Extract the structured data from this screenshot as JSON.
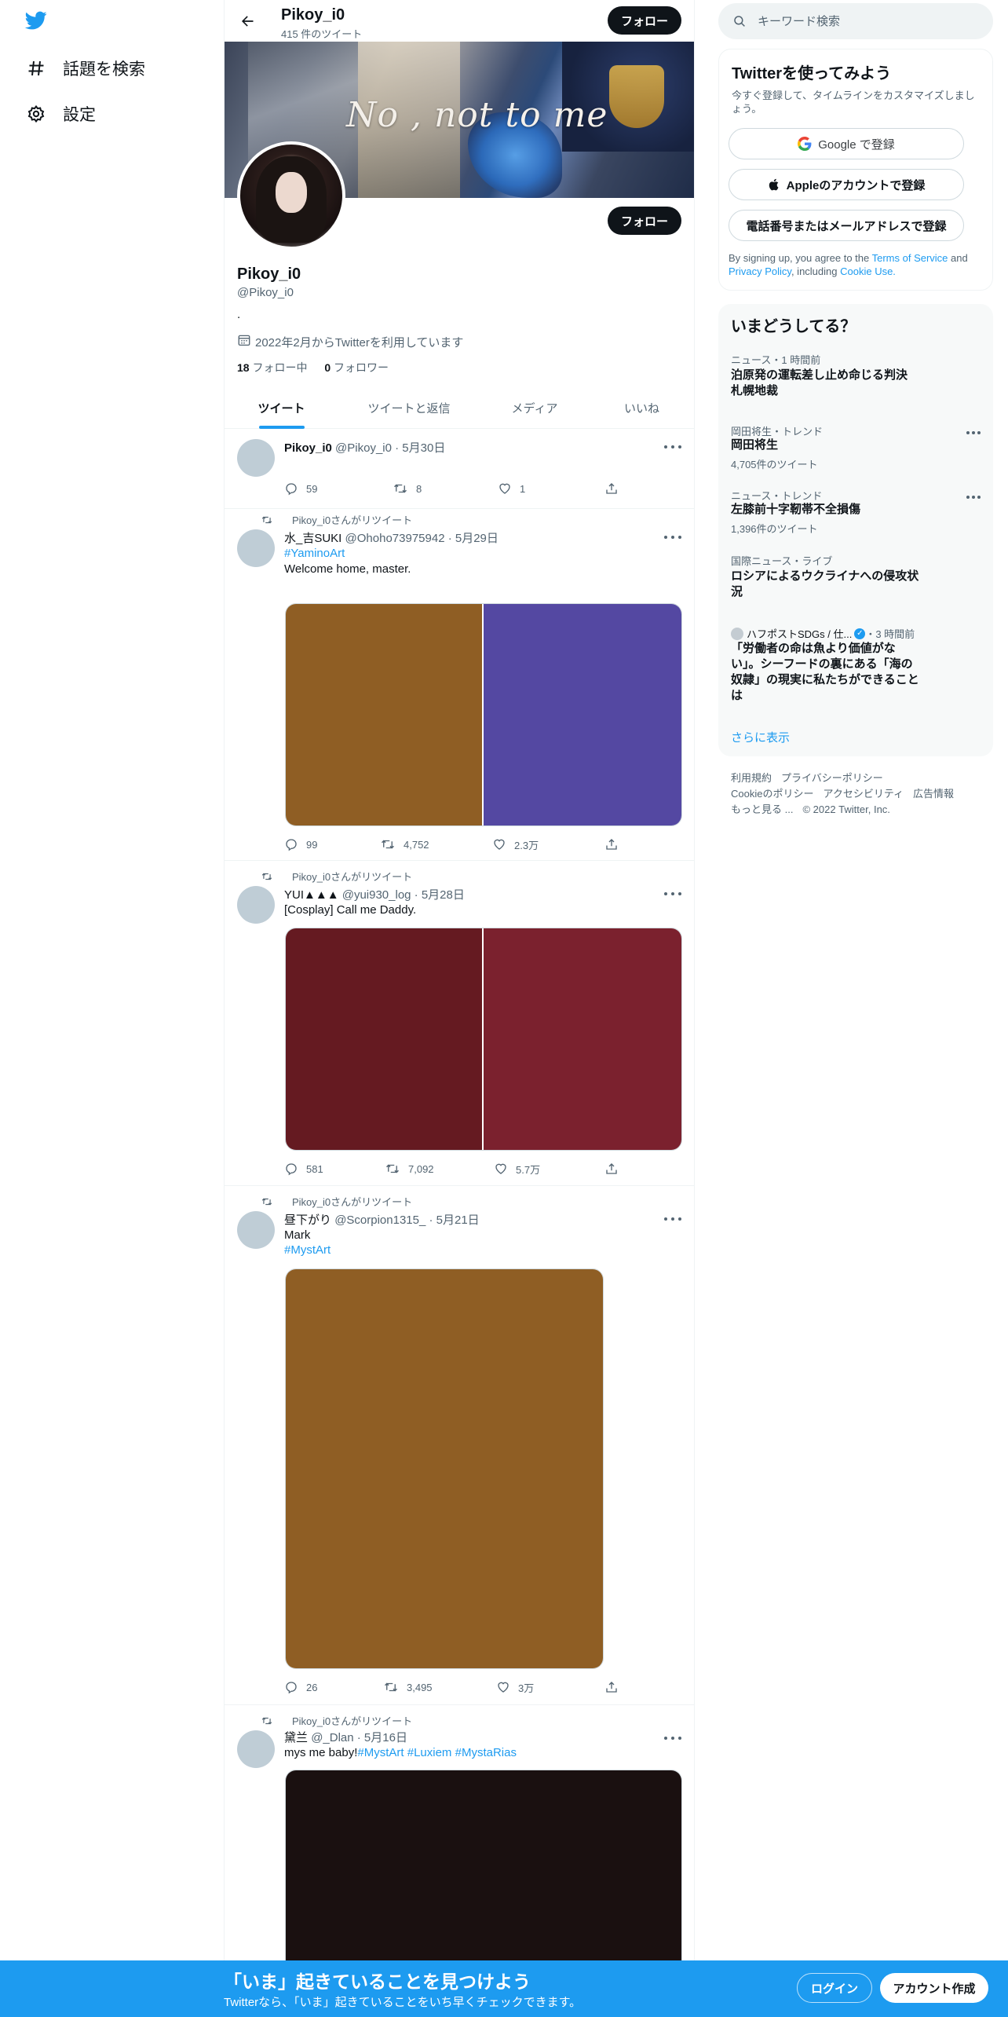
{
  "nav": {
    "explore_label": "話題を検索",
    "settings_label": "設定"
  },
  "header": {
    "name": "Pikoy_i0",
    "tweet_count": "415 件のツイート",
    "follow_label": "フォロー"
  },
  "profile": {
    "banner_text": "No , not to me",
    "name": "Pikoy_i0",
    "handle": "@Pikoy_i0",
    "bio": ".",
    "joined": "2022年2月からTwitterを利用しています",
    "following_count": "18",
    "following_label": "フォロー中",
    "followers_count": "0",
    "followers_label": "フォロワー",
    "follow_label": "フォロー"
  },
  "tabs": [
    {
      "label": "ツイート"
    },
    {
      "label": "ツイートと返信"
    },
    {
      "label": "メディア"
    },
    {
      "label": "いいね"
    }
  ],
  "tweets": [
    {
      "name": "Pikoy_i0",
      "meta": "@Pikoy_i0 · 5月30日",
      "replies": "59",
      "retweets": "8",
      "likes": "1"
    },
    {
      "retweet_label": "Pikoy_i0さんがリツイート",
      "name": "水_吉SUKI",
      "meta": "@Ohoho73975942 · 5月29日",
      "hashtag": "#YaminoArt",
      "text": "Welcome home, master.",
      "media_colors": [
        "#8f5e24",
        "#5448a2"
      ],
      "replies": "99",
      "retweets": "4,752",
      "likes": "2.3万"
    },
    {
      "retweet_label": "Pikoy_i0さんがリツイート",
      "name": "YUI▲▲▲",
      "meta": "@yui930_log · 5月28日",
      "text": "[Cosplay] Call me Daddy.",
      "media_colors": [
        "#651a21",
        "#7b212e"
      ],
      "replies": "581",
      "retweets": "7,092",
      "likes": "5.7万"
    },
    {
      "retweet_label": "Pikoy_i0さんがリツイート",
      "name": "昼下がり",
      "meta": "@Scorpion1315_ · 5月21日",
      "text": "Mark",
      "hashtag": " #MystArt",
      "media_colors": [
        "#8f5e24"
      ],
      "replies": "26",
      "retweets": "3,495",
      "likes": "3万"
    },
    {
      "retweet_label": "Pikoy_i0さんがリツイート",
      "name": "黛兰",
      "meta": "@_Dlan · 5月16日",
      "text": "mys me baby!",
      "tags": [
        "#MystArt",
        "#Luxiem",
        "#MystaRias"
      ],
      "media_colors": [
        "#1a1010"
      ]
    }
  ],
  "search": {
    "placeholder": "キーワード検索"
  },
  "signup_card": {
    "title": "Twitterを使ってみよう",
    "subtitle": "今すぐ登録して、タイムラインをカスタマイズしましょう。",
    "google": "Google で登録",
    "apple": "Appleのアカウントで登録",
    "phone": "電話番号またはメールアドレスで登録",
    "legal_prefix": "By signing up, you agree to the ",
    "terms": "Terms of Service",
    "and": " and ",
    "privacy": "Privacy Policy",
    "including": ", including ",
    "cookie": "Cookie Use."
  },
  "trends": {
    "title": "いまどうしてる？",
    "items": [
      {
        "category": "ニュース・1 時間前",
        "title": "泊原発の運転差し止め命じる判決　札幌地裁"
      },
      {
        "category": "岡田将生・トレンド",
        "title": "岡田将生",
        "meta": "4,705件のツイート"
      },
      {
        "category": "ニュース・トレンド",
        "title": "左膝前十字靭帯不全損傷",
        "meta": "1,396件のツイート"
      },
      {
        "category": "国際ニュース・ライブ",
        "title": "ロシアによるウクライナへの侵攻状況"
      },
      {
        "category": "ハフポストSDGs / 仕...",
        "time": "・3 時間前",
        "title": "「労働者の命は魚より価値がない」。シーフードの裏にある「海の奴隷」の現実に私たちができることは"
      }
    ],
    "show_more": "さらに表示"
  },
  "footer": {
    "terms": "利用規約",
    "privacy": "プライバシーポリシー",
    "cookie": "Cookieのポリシー",
    "accessibility": "アクセシビリティ",
    "ads": "広告情報",
    "more": "もっと見る ...",
    "copyright": "© 2022 Twitter, Inc."
  },
  "bottom_banner": {
    "title": "「いま」起きていることを見つけよう",
    "subtitle": "Twitterなら、「いま」起きていることをいち早くチェックできます。",
    "login": "ログイン",
    "signup": "アカウント作成"
  },
  "colors": {
    "accent": "#1d9bf0",
    "text": "#0f1419",
    "muted": "#536471"
  }
}
